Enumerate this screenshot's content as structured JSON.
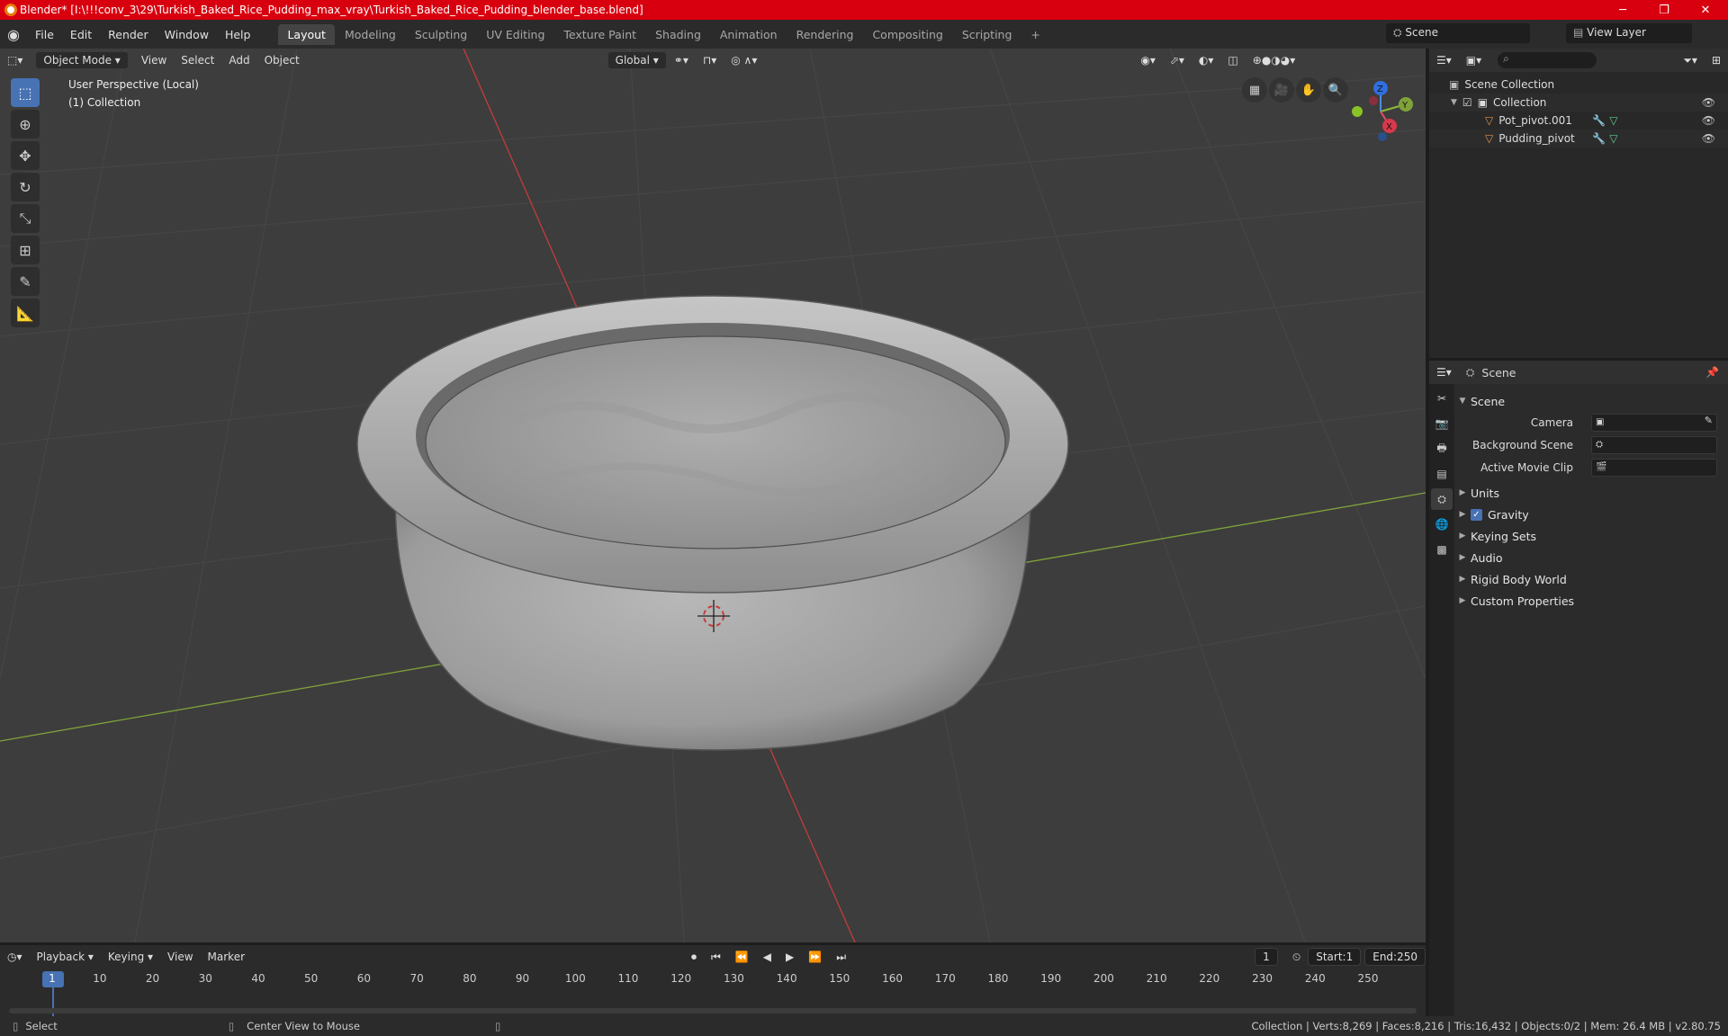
{
  "window": {
    "title": "Blender* [I:\\!!!conv_3\\29\\Turkish_Baked_Rice_Pudding_max_vray\\Turkish_Baked_Rice_Pudding_blender_base.blend]",
    "minimize": "─",
    "maximize": "❐",
    "close": "✕"
  },
  "menu": {
    "file": "File",
    "edit": "Edit",
    "render": "Render",
    "window": "Window",
    "help": "Help"
  },
  "workspaces": [
    "Layout",
    "Modeling",
    "Sculpting",
    "UV Editing",
    "Texture Paint",
    "Shading",
    "Animation",
    "Rendering",
    "Compositing",
    "Scripting"
  ],
  "workspace_add": "+",
  "scene_selector": "Scene",
  "view_layer_selector": "View Layer",
  "viewport": {
    "mode": "Object Mode",
    "menus": {
      "view": "View",
      "select": "Select",
      "add": "Add",
      "object": "Object"
    },
    "orientation": "Global",
    "info_line1": "User Perspective (Local)",
    "info_line2": "(1) Collection",
    "gizmo": {
      "z": "Z",
      "y": "Y",
      "x": "X"
    }
  },
  "outliner": {
    "scene_collection": "Scene Collection",
    "collection": "Collection",
    "objects": [
      "Pot_pivot.001",
      "Pudding_pivot"
    ]
  },
  "properties": {
    "header": "Scene",
    "panel": "Scene",
    "camera_label": "Camera",
    "background_scene_label": "Background Scene",
    "active_movie_clip_label": "Active Movie Clip",
    "units": "Units",
    "gravity": "Gravity",
    "keying_sets": "Keying Sets",
    "audio": "Audio",
    "rigid_body_world": "Rigid Body World",
    "custom_properties": "Custom Properties"
  },
  "timeline": {
    "playback": "Playback",
    "keying": "Keying",
    "view": "View",
    "marker": "Marker",
    "current_frame": "1",
    "start_label": "Start:",
    "start": "1",
    "end_label": "End:",
    "end": "250",
    "ticks": [
      "1",
      "10",
      "20",
      "30",
      "40",
      "50",
      "60",
      "70",
      "80",
      "90",
      "100",
      "110",
      "120",
      "130",
      "140",
      "150",
      "160",
      "170",
      "180",
      "190",
      "200",
      "210",
      "220",
      "230",
      "240",
      "250"
    ]
  },
  "status": {
    "select": "Select",
    "center_view": "Center View to Mouse",
    "stats": "Collection | Verts:8,269 | Faces:8,216 | Tris:16,432 | Objects:0/2 | Mem: 26.4 MB | v2.80.75"
  },
  "colors": {
    "title_bar": "#d8000f",
    "accent": "#4772b3",
    "viewport_bg": "#3d3d3d",
    "x_axis": "#c43c3c",
    "y_axis": "#7fa33a"
  }
}
